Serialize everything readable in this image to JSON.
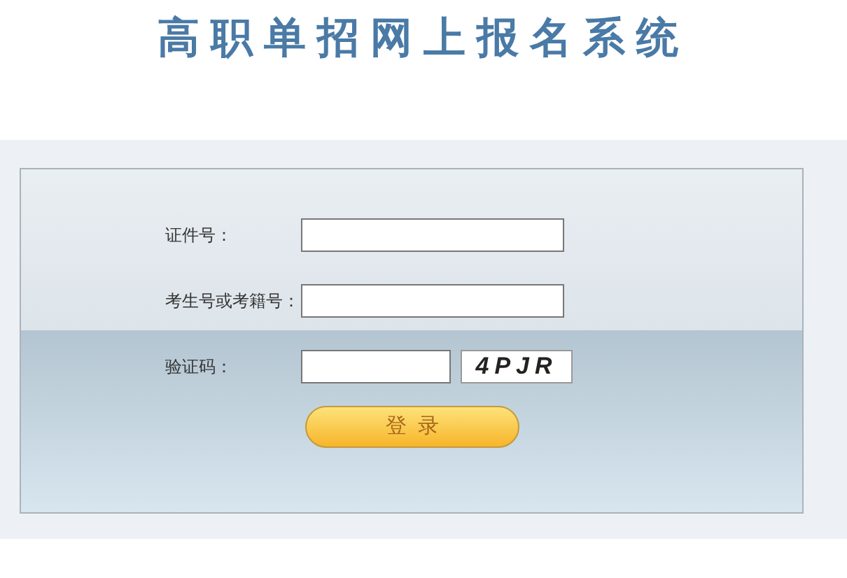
{
  "title": "高职单招网上报名系统",
  "fields": [
    {
      "label": "证件号：",
      "kind": "text"
    },
    {
      "label": "考生号或考籍号：",
      "kind": "text"
    },
    {
      "label": "验证码：",
      "kind": "captcha",
      "captcha": "4PJR"
    }
  ],
  "login_button": "登  录"
}
